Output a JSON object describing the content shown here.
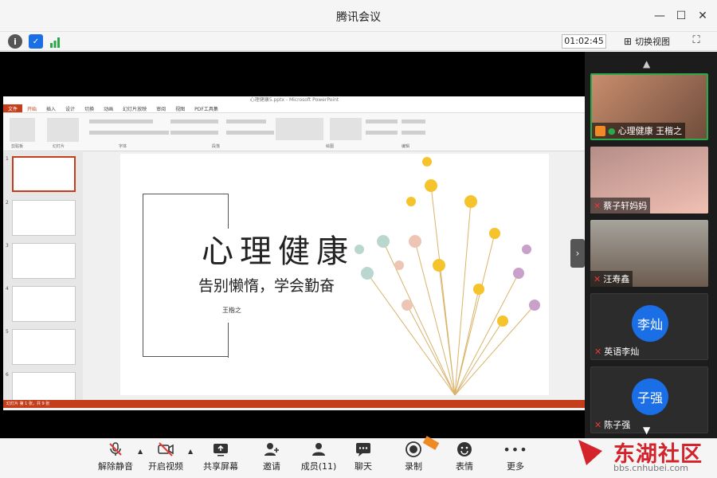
{
  "window": {
    "title": "腾讯会议"
  },
  "top": {
    "timer": "01:02:45",
    "switch_view": "切换视图"
  },
  "ppt": {
    "title": "心理健康5.pptx - Microsoft PowerPoint",
    "tabs": [
      "文件",
      "开始",
      "插入",
      "设计",
      "切换",
      "动画",
      "幻灯片放映",
      "审阅",
      "视图",
      "PDF工具集"
    ],
    "groups": [
      "剪贴板",
      "幻灯片",
      "字体",
      "段落",
      "绘图",
      "编辑"
    ],
    "thumb_numbers": [
      "1",
      "2",
      "3",
      "4",
      "5",
      "6"
    ],
    "status": "幻灯片 第 1 张，共 9 张",
    "slide": {
      "title": "心理健康",
      "subtitle": "告别懒惰，学会勤奋",
      "author": "王楷之"
    }
  },
  "participants": [
    {
      "name": "心理健康 王楷之",
      "muted": false
    },
    {
      "name": "蔡子轩妈妈",
      "muted": true
    },
    {
      "name": "汪寿鑫",
      "muted": true
    },
    {
      "name": "英语李灿",
      "muted": true,
      "avatar": "李灿"
    },
    {
      "name": "陈子强",
      "muted": true,
      "avatar": "子强"
    }
  ],
  "bottom": {
    "mute": "解除静音",
    "video": "开启视频",
    "share": "共享屏幕",
    "invite": "邀请",
    "members": "成员(11)",
    "chat": "聊天",
    "record": "录制",
    "emoji": "表情",
    "more": "更多"
  },
  "watermark": {
    "text": "东湖社区",
    "url": "bbs.cnhubei.com"
  },
  "colors": {
    "accent": "#1a6ee6",
    "ppt_red": "#c43e1c",
    "record_badge": "#f08a24"
  }
}
